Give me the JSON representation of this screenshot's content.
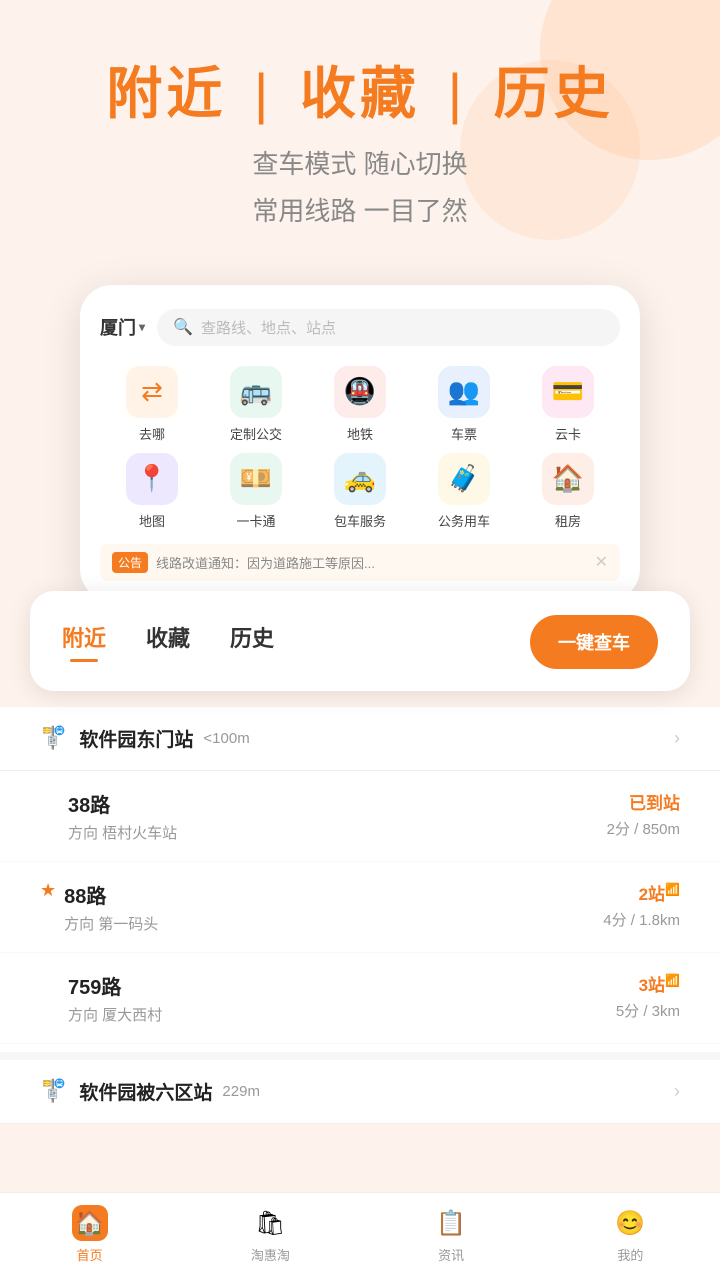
{
  "header": {
    "title_part1": "附近",
    "divider": "|",
    "title_part2": "收藏",
    "divider2": "|",
    "title_part3": "历史",
    "subtitle_line1": "查车模式 随心切换",
    "subtitle_line2": "常用线路 一目了然"
  },
  "phone": {
    "city": "厦门",
    "search_placeholder": "查路线、地点、站点",
    "icons": [
      {
        "label": "去哪",
        "icon": "🔀",
        "color_class": "icon-orange"
      },
      {
        "label": "定制公交",
        "icon": "🚌",
        "color_class": "icon-green"
      },
      {
        "label": "地铁",
        "icon": "🚇",
        "color_class": "icon-red"
      },
      {
        "label": "车票",
        "icon": "👥",
        "color_class": "icon-blue"
      },
      {
        "label": "云卡",
        "icon": "💳",
        "color_class": "icon-pink"
      },
      {
        "label": "地图",
        "icon": "📍",
        "color_class": "icon-purple"
      },
      {
        "label": "一卡通",
        "icon": "💴",
        "color_class": "icon-green"
      },
      {
        "label": "包车服务",
        "icon": "🚕",
        "color_class": "icon-skyblue"
      },
      {
        "label": "公务用车",
        "icon": "🧳",
        "color_class": "icon-yellow"
      },
      {
        "label": "租房",
        "icon": "🏠",
        "color_class": "icon-salmon"
      }
    ],
    "announcement": {
      "tag": "公告",
      "text": "线路改道通知：因为道路施工等原因..."
    }
  },
  "tabs": {
    "items": [
      {
        "label": "附近",
        "active": true
      },
      {
        "label": "收藏",
        "active": false
      },
      {
        "label": "历史",
        "active": false
      }
    ],
    "button": "一键查车"
  },
  "stations": [
    {
      "name": "软件园东门站",
      "distance": "<100m",
      "buses": [
        {
          "number": "38路",
          "direction": "方向 梧村火车站",
          "status": "已到站",
          "status_type": "arrived",
          "time": "2分 / 850m",
          "starred": false
        },
        {
          "number": "88路",
          "direction": "方向 第一码头",
          "status": "2站",
          "status_type": "stops",
          "time": "4分 / 1.8km",
          "starred": true,
          "wifi": true
        },
        {
          "number": "759路",
          "direction": "方向 厦大西村",
          "status": "3站",
          "status_type": "stops",
          "time": "5分 / 3km",
          "starred": false,
          "wifi": true
        }
      ]
    },
    {
      "name": "软件园被六区站",
      "distance": "229m",
      "buses": []
    }
  ],
  "bottom_nav": [
    {
      "label": "首页",
      "active": true,
      "icon": "🏠"
    },
    {
      "label": "淘惠淘",
      "active": false,
      "icon": "🛍"
    },
    {
      "label": "资讯",
      "active": false,
      "icon": "📋"
    },
    {
      "label": "我的",
      "active": false,
      "icon": "😊"
    }
  ]
}
